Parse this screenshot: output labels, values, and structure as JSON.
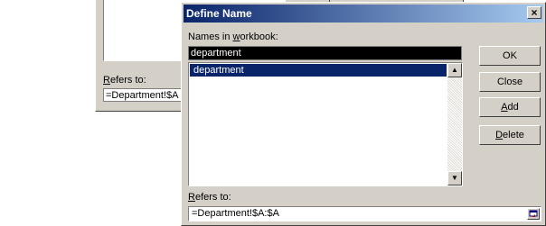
{
  "background_dialog": {
    "refers_to_label_prefix": "R",
    "refers_to_label_rest": "efers to:",
    "refers_to_value": "=Department!$A"
  },
  "dialog": {
    "title": "Define Name",
    "close_label": "×",
    "names_label_prefix": "Names in ",
    "names_label_underlined": "w",
    "names_label_rest": "orkbook:",
    "name_input_value": "department",
    "names_list": [
      "department"
    ],
    "refers_to_label_prefix": "R",
    "refers_to_label_rest": "efers to:",
    "refers_to_value": "=Department!$A:$A",
    "buttons": {
      "ok": "OK",
      "close": "Close",
      "add_underlined": "A",
      "add_rest": "dd",
      "delete_underlined": "D",
      "delete_rest": "elete"
    },
    "colors": {
      "title_gradient_start": "#0a246a",
      "title_gradient_end": "#a6caf0",
      "selection": "#0a246a",
      "face": "#d4d0c8"
    }
  }
}
